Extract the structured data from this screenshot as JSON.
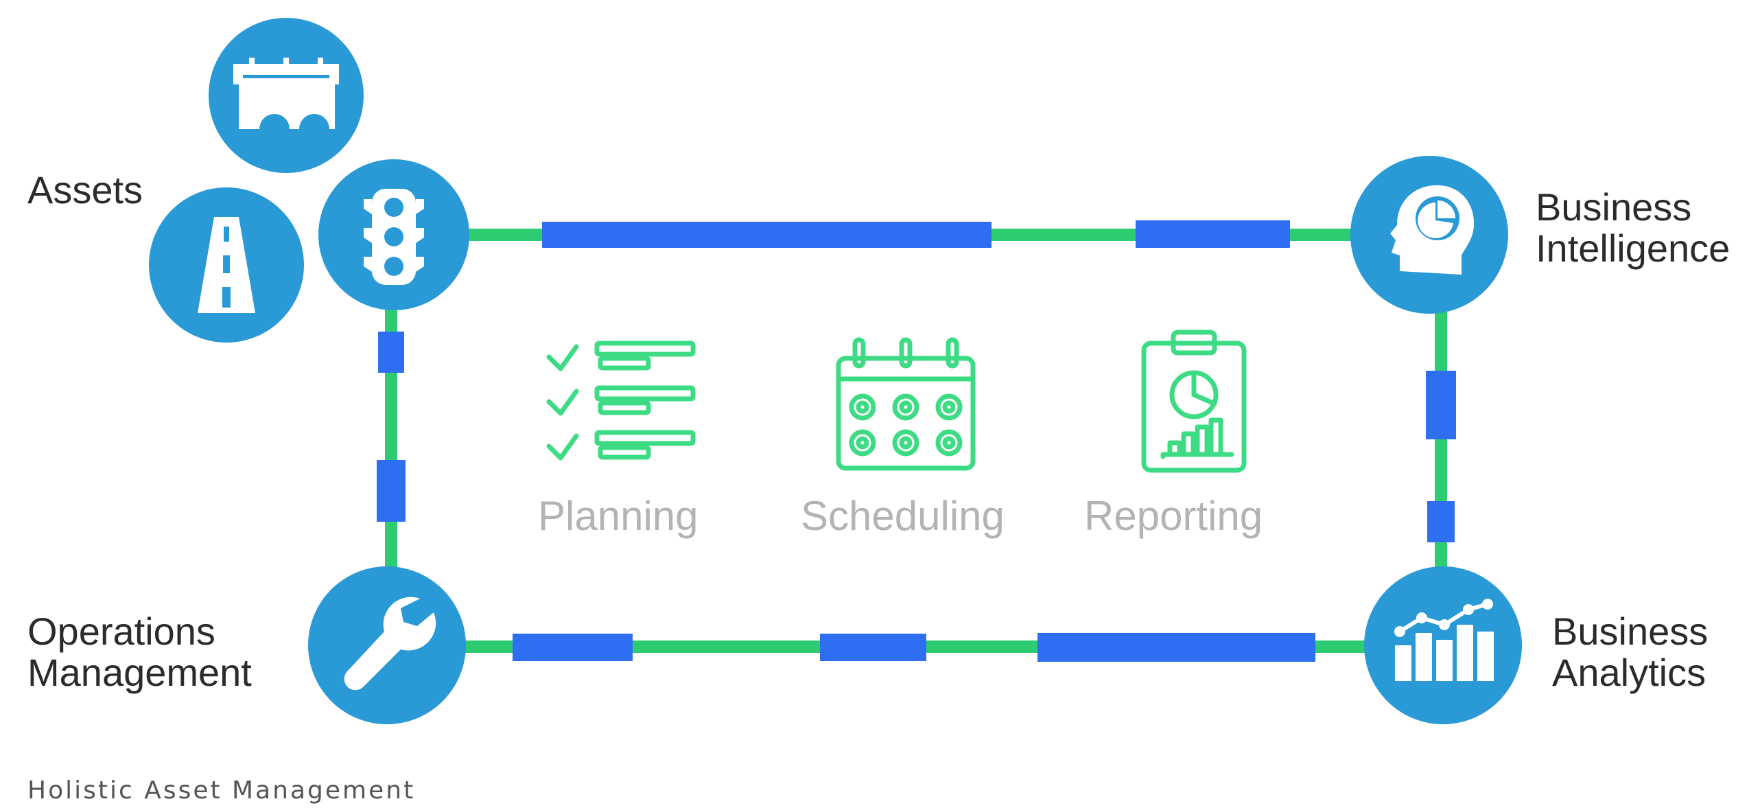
{
  "colors": {
    "track": "#2ecc71",
    "dash": "#2d6ff0",
    "node": "#2a9ad6",
    "icon_fill": "#ffffff",
    "task_icon": "#3ddc84",
    "task_label": "#b3b3b3",
    "text": "#2b2b2b",
    "caption": "#555555"
  },
  "nodes": {
    "assets": {
      "label": "Assets",
      "icons": [
        "bridge-icon",
        "road-icon",
        "traffic-light-icon"
      ]
    },
    "business_intelligence": {
      "label_lines": [
        "Business",
        "Intelligence"
      ],
      "icon": "head-pie-chart-icon"
    },
    "operations_management": {
      "label_lines": [
        "Operations",
        "Management"
      ],
      "icon": "wrench-icon"
    },
    "business_analytics": {
      "label_lines": [
        "Business",
        "Analytics"
      ],
      "icon": "bar-chart-trend-icon"
    }
  },
  "tasks": [
    {
      "label": "Planning",
      "icon": "checklist-icon"
    },
    {
      "label": "Scheduling",
      "icon": "calendar-icon"
    },
    {
      "label": "Reporting",
      "icon": "clipboard-report-icon"
    }
  ],
  "caption": "Holistic Asset Management"
}
